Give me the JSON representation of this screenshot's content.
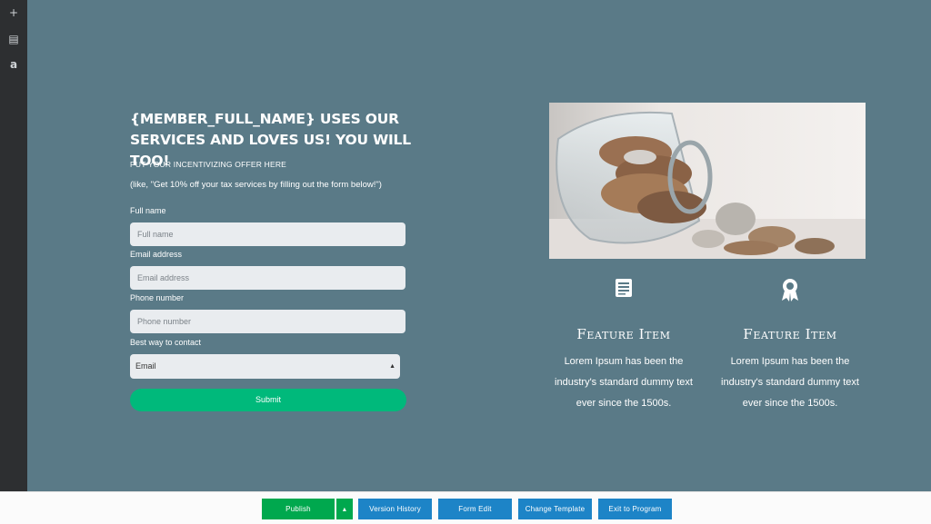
{
  "sidebar": {
    "items": [
      {
        "icon": "plus-icon",
        "glyph": "+"
      },
      {
        "icon": "document-icon",
        "glyph": "▤"
      },
      {
        "icon": "text-icon",
        "glyph": "a"
      }
    ]
  },
  "form": {
    "headline": "{MEMBER_FULL_NAME} USES OUR SERVICES AND LOVES US! YOU WILL TOO!",
    "subhead": "PUT YOUR INCENTIVIZING OFFER HERE",
    "offer_example": "(like, \"Get 10% off your tax services by filling out the form below!\")",
    "full_name": {
      "label": "Full name",
      "placeholder": "Full name"
    },
    "email": {
      "label": "Email address",
      "placeholder": "Email address"
    },
    "phone": {
      "label": "Phone number",
      "placeholder": "Phone number"
    },
    "contact": {
      "label": "Best way to contact",
      "selected": "Email"
    },
    "submit_label": "Submit"
  },
  "features": [
    {
      "icon": "newspaper-icon",
      "title": "Feature Item",
      "description": "Lorem Ipsum has been the industry's standard dummy text ever since the 1500s."
    },
    {
      "icon": "award-ribbon-icon",
      "title": "Feature Item",
      "description": "Lorem Ipsum has been the industry's standard dummy text ever since the 1500s."
    }
  ],
  "toolbar": {
    "publish_label": "Publish",
    "version_history_label": "Version History",
    "form_edit_label": "Form Edit",
    "change_template_label": "Change Template",
    "exit_label": "Exit to Program"
  },
  "colors": {
    "background": "#5a7a87",
    "submit": "#00b97b",
    "publish": "#00a84e",
    "toolbar_button": "#1d84c7"
  }
}
